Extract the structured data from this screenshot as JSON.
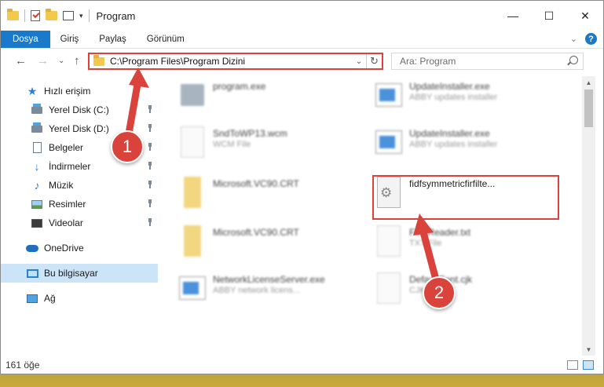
{
  "window": {
    "title": "Program",
    "controls": {
      "minimize": "—",
      "maximize": "☐",
      "close": "✕"
    }
  },
  "ribbon": {
    "tabs": [
      "Dosya",
      "Giriş",
      "Paylaş",
      "Görünüm"
    ]
  },
  "address": {
    "path": "C:\\Program Files\\Program Dizini"
  },
  "search": {
    "placeholder": "Ara: Program"
  },
  "sidebar": {
    "items": [
      {
        "label": "Hızlı erişim",
        "icon": "star-icon",
        "pinned": false
      },
      {
        "label": "Yerel Disk (C:)",
        "icon": "disk-icon",
        "pinned": true
      },
      {
        "label": "Yerel Disk (D:)",
        "icon": "disk-icon",
        "pinned": true
      },
      {
        "label": "Belgeler",
        "icon": "document-icon",
        "pinned": true
      },
      {
        "label": "İndirmeler",
        "icon": "download-icon",
        "pinned": true
      },
      {
        "label": "Müzik",
        "icon": "music-icon",
        "pinned": true
      },
      {
        "label": "Resimler",
        "icon": "pictures-icon",
        "pinned": true
      },
      {
        "label": "Videolar",
        "icon": "videos-icon",
        "pinned": true
      },
      {
        "label": "OneDrive",
        "icon": "cloud-icon",
        "pinned": false
      },
      {
        "label": "Bu bilgisayar",
        "icon": "computer-icon",
        "pinned": false,
        "selected": true
      },
      {
        "label": "Ağ",
        "icon": "network-icon",
        "pinned": false
      }
    ]
  },
  "files": [
    {
      "name": "program.exe",
      "desc": "",
      "icon": "exe",
      "blur": true
    },
    {
      "name": "UpdateInstaller.exe",
      "desc": "ABBY updates installer",
      "icon": "installer",
      "blur": true
    },
    {
      "name": "SndToWP13.wcm",
      "desc": "WCM File",
      "icon": "blank",
      "blur": true
    },
    {
      "name": "UpdateInstaller.exe",
      "desc": "ABBY updates installer",
      "icon": "installer",
      "blur": true
    },
    {
      "name": "Microsoft.VC90.CRT",
      "desc": "",
      "icon": "folder",
      "blur": true
    },
    {
      "name": "fidfsymmetricfirfilte...",
      "desc": "",
      "icon": "gear",
      "blur": false
    },
    {
      "name": "Microsoft.VC90.CRT",
      "desc": "",
      "icon": "folder",
      "blur": true
    },
    {
      "name": "FineReader.txt",
      "desc": "TXT File",
      "icon": "blank",
      "blur": true
    },
    {
      "name": "NetworkLicenseServer.exe",
      "desc": "ABBY network licens...",
      "icon": "installer",
      "blur": true
    },
    {
      "name": "DefaultFont.cjk",
      "desc": "CJK File",
      "icon": "blank",
      "blur": true
    }
  ],
  "status": {
    "count": "161 öğe"
  },
  "callouts": [
    "1",
    "2"
  ],
  "colors": {
    "accent": "#1979ca",
    "highlight": "#e0403a",
    "callout": "#d9433c"
  }
}
